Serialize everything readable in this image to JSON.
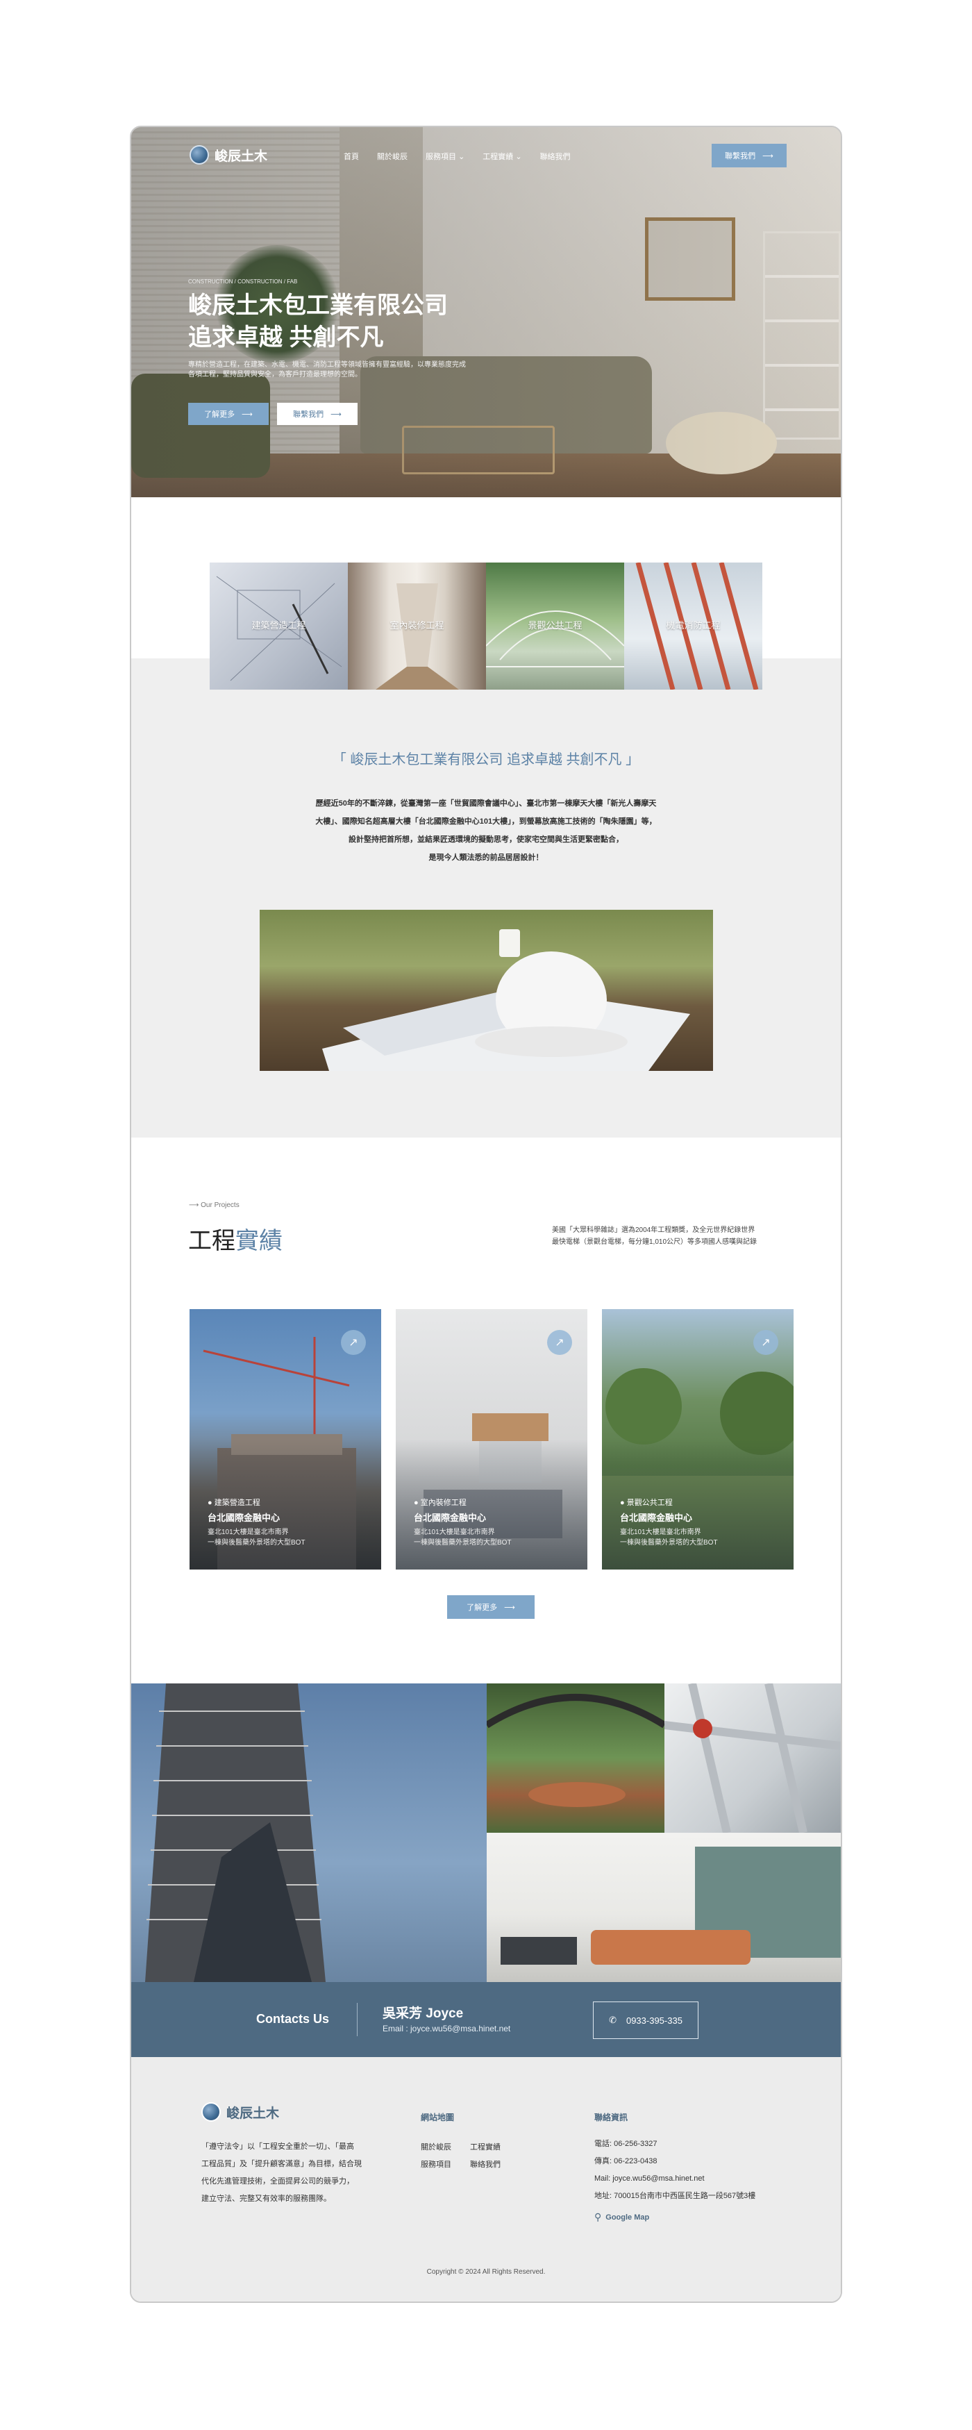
{
  "colors": {
    "accent": "#7fa6c9",
    "brand_dark": "#4e6a82",
    "title_blue": "#5c82a6",
    "section_grey": "#efefef"
  },
  "header": {
    "logo_text": "峻辰土木",
    "nav": [
      "首頁",
      "關於峻辰",
      "服務項目",
      "工程實績",
      "聯絡我們"
    ],
    "cta_label": "聯繫我們"
  },
  "hero": {
    "crumb": "CONSTRUCTION / CONSTRUCTION / FAB",
    "title_line1": "峻辰土木包工業有限公司",
    "title_line2": "追求卓越 共創不凡",
    "desc_line1": "專精於營造工程，在建築、水電、機電、消防工程等領域皆擁有豐富經驗，以專業態度完成",
    "desc_line2": "各項工程，堅持品質與安全，為客戶打造最理想的空間。",
    "btn_more": "了解更多",
    "btn_contact": "聯繫我們"
  },
  "services": [
    {
      "label": "建築營造工程",
      "icon": "blueprint-image"
    },
    {
      "label": "室內裝修工程",
      "icon": "corridor-image"
    },
    {
      "label": "景觀公共工程",
      "icon": "greenhouse-image"
    },
    {
      "label": "機電消防工程",
      "icon": "pipes-image"
    }
  ],
  "intro": {
    "quote": "「 峻辰土木包工業有限公司  追求卓越 共創不凡 」",
    "p1": "歷經近50年的不斷淬鍊，從臺灣第一座「世貿國際會議中心」、臺北市第一棟摩天大樓「新光人壽摩天",
    "p2": "大樓」、國際知名超高層大樓「台北國際金融中心101大樓」，到螢幕放高施工技術的「陶朱隱園」等，",
    "p3": "設計堅持把首所想，並結果匠透環境的擬動思考，使家宅空間與生活更緊密點合，",
    "p4": "是現今人類法悉的前品居居設計！"
  },
  "projects": {
    "kicker": "Our Projects",
    "title_dark": "工程",
    "title_blue": "實績",
    "desc_line1": "美國「大眾科學雜誌」選為2004年工程類獎，及全元世界紀錄世界",
    "desc_line2": "最快電梯（景觀台電梯，每分鐘1,010公尺）等多項國人感嘆與記錄",
    "cards": [
      {
        "tag": "● 建築營造工程",
        "name": "台北國際金融中心",
        "text1": "臺北101大樓是臺北市南界",
        "text2": "一棟與後醫藥外景塔的大型BOT"
      },
      {
        "tag": "● 室內裝修工程",
        "name": "台北國際金融中心",
        "text1": "臺北101大樓是臺北市南界",
        "text2": "一棟與後醫藥外景塔的大型BOT"
      },
      {
        "tag": "● 景觀公共工程",
        "name": "台北國際金融中心",
        "text1": "臺北101大樓是臺北市南界",
        "text2": "一棟與後醫藥外景塔的大型BOT"
      }
    ],
    "more_label": "了解更多"
  },
  "contact_bar": {
    "label": "Contacts Us",
    "name": "吳采芳 Joyce",
    "email": "Email : joyce.wu56@msa.hinet.net",
    "phone": "0933-395-335"
  },
  "footer": {
    "logo_text": "峻辰土木",
    "about1": "「遵守法令」以「工程安全重於一切」、「最高",
    "about2": "工程品質」及「提升顧客滿意」為目標，結合現",
    "about3": "代化先進管理技術，全面提昇公司的競爭力，",
    "about4": "建立守法、完整又有效率的服務團隊。",
    "sitemap_head": "網站地圖",
    "sitemap": [
      "關於峻辰",
      "工程實績",
      "服務項目",
      "聯絡我們"
    ],
    "contact_head": "聯絡資訊",
    "tel": "電話: 06-256-3327",
    "fax": "傳真: 06-223-0438",
    "mail": "Mail: joyce.wu56@msa.hinet.net",
    "addr": "地址: 700015台南市中西區民生路一段567號3樓",
    "map_label": "Google Map",
    "copyright": "Copyright © 2024 All Rights Reserved."
  }
}
